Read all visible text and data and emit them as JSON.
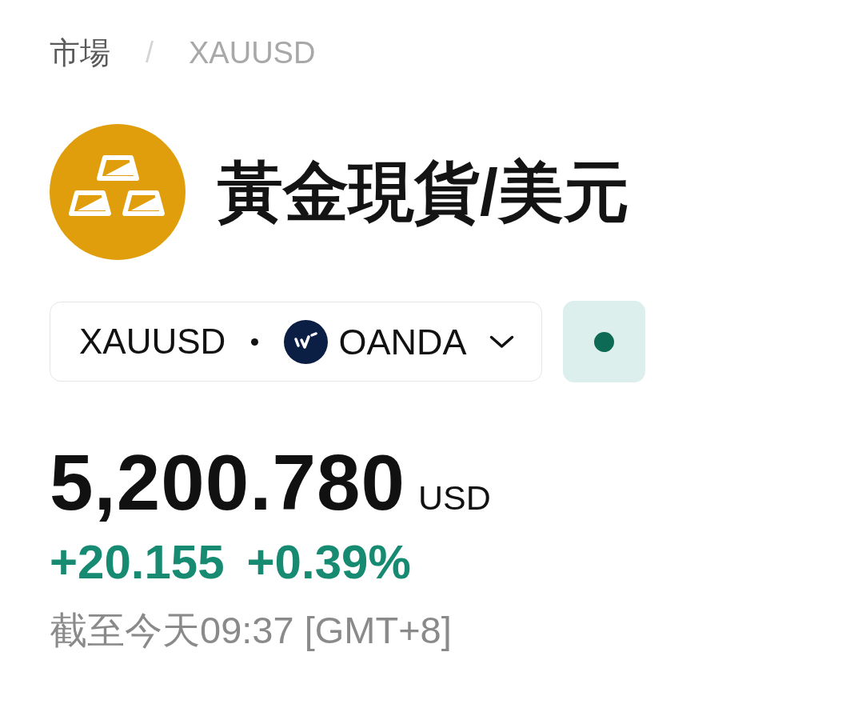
{
  "breadcrumb": {
    "separator": "/",
    "items": [
      {
        "label": "市場",
        "current": false
      },
      {
        "label": "XAUUSD",
        "current": true
      }
    ]
  },
  "instrument": {
    "title": "黃金現貨/美元"
  },
  "selector": {
    "symbol": "XAUUSD",
    "broker": "OANDA"
  },
  "market_status": {
    "open": true
  },
  "quote": {
    "price": "5,200.780",
    "currency": "USD",
    "change": "+20.155",
    "change_percent": "+0.39%",
    "rising": true
  },
  "timestamp": "截至今天09:37 [GMT+8]"
}
